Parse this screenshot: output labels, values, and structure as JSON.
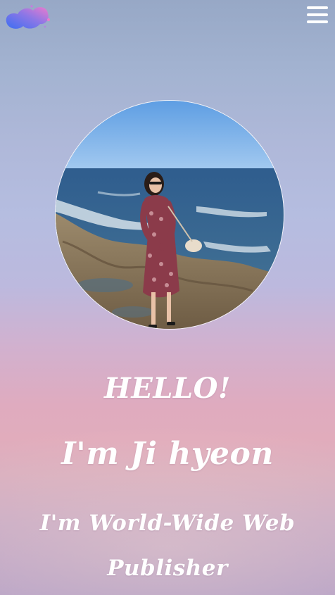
{
  "header": {
    "logo_icon": "blob-logo-icon",
    "menu_icon": "hamburger-menu-icon"
  },
  "profile": {
    "photo_description_icon": "profile-photo"
  },
  "hero": {
    "greeting": "HELLO!",
    "name_line": "I'm Ji hyeon",
    "role_line_1": "I'm World-Wide Web",
    "role_line_2": "Publisher"
  },
  "colors": {
    "logo_blue": "#3b6df0",
    "logo_pink": "#e27ad0",
    "text": "#ffffff"
  }
}
